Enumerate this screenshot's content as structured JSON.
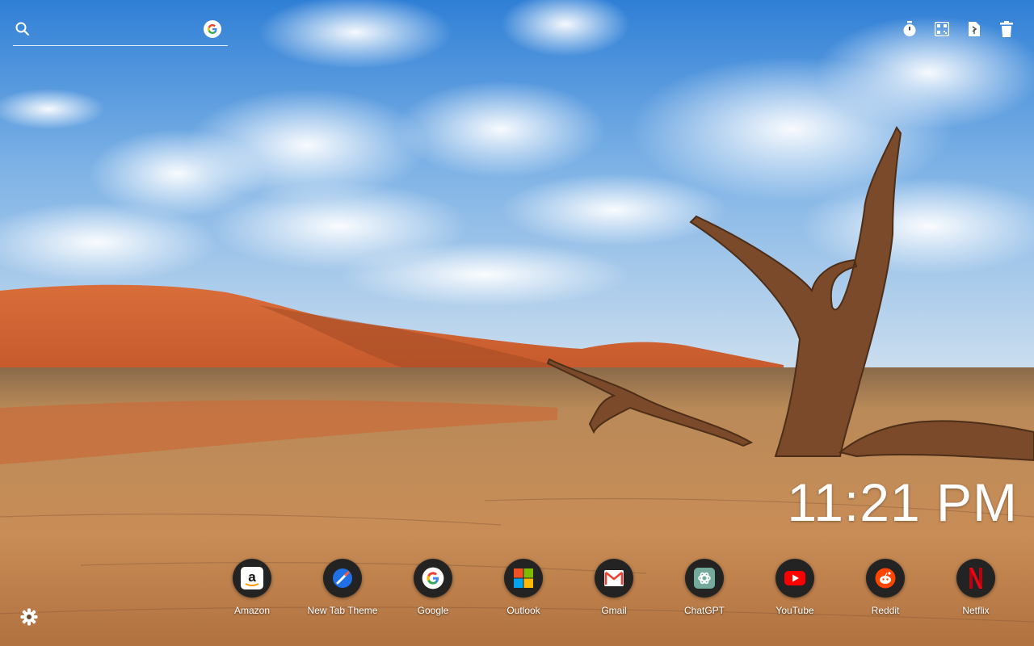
{
  "search": {
    "placeholder": ""
  },
  "toolbar": {
    "icons": [
      "timer-icon",
      "qr-code-icon",
      "share-file-icon",
      "trash-icon"
    ]
  },
  "clock": {
    "time": "11:21 PM"
  },
  "apps": [
    {
      "label": "Amazon",
      "icon": "amazon-icon"
    },
    {
      "label": "New Tab Theme",
      "icon": "new-tab-theme-icon"
    },
    {
      "label": "Google",
      "icon": "google-icon"
    },
    {
      "label": "Outlook",
      "icon": "outlook-icon"
    },
    {
      "label": "Gmail",
      "icon": "gmail-icon"
    },
    {
      "label": "ChatGPT",
      "icon": "chatgpt-icon"
    },
    {
      "label": "YouTube",
      "icon": "youtube-icon"
    },
    {
      "label": "Reddit",
      "icon": "reddit-icon"
    },
    {
      "label": "Netflix",
      "icon": "netflix-icon"
    }
  ],
  "settings": {
    "icon": "gear-icon"
  },
  "colors": {
    "sky": "#3f87d8",
    "sand": "#c98a55",
    "dune": "#d2693a",
    "text": "#ffffff"
  }
}
